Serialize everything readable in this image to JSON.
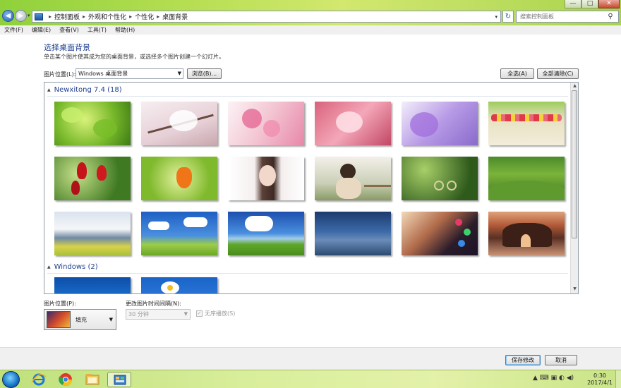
{
  "window": {
    "breadcrumbs": [
      "控制面板",
      "外观和个性化",
      "个性化",
      "桌面背景"
    ],
    "search_placeholder": "搜索控制面板",
    "controls": {
      "minimize": "—",
      "maximize": "□",
      "close": "✕"
    }
  },
  "menu": [
    "文件(F)",
    "编辑(E)",
    "查看(V)",
    "工具(T)",
    "帮助(H)"
  ],
  "main": {
    "title": "选择桌面背景",
    "description": "单击某个图片使其成为您的桌面背景，或选择多个图片创建一个幻灯片。",
    "location_label": "图片位置(L):",
    "location_value": "Windows 桌面背景",
    "browse_label": "浏览(B)...",
    "select_all_label": "全选(A)",
    "clear_all_label": "全部清除(C)"
  },
  "groups": [
    {
      "name": "Newxitong 7.4 (18)"
    },
    {
      "name": "Windows (2)"
    }
  ],
  "thumbnails": [
    {
      "name": "green-leaves"
    },
    {
      "name": "cherry-blossom-white"
    },
    {
      "name": "pink-blossom"
    },
    {
      "name": "peach-blossom"
    },
    {
      "name": "purple-flowers"
    },
    {
      "name": "tulip-field"
    },
    {
      "name": "red-tulips"
    },
    {
      "name": "lantern-flower"
    },
    {
      "name": "portrait-woman"
    },
    {
      "name": "girl-fence"
    },
    {
      "name": "bicycle-forest"
    },
    {
      "name": "green-hills"
    },
    {
      "name": "mountain-clouds"
    },
    {
      "name": "blue-sky-meadow"
    },
    {
      "name": "sky-field"
    },
    {
      "name": "evening-sky"
    },
    {
      "name": "cup-bokeh"
    },
    {
      "name": "sea-rock-arch"
    },
    {
      "name": "windows-blue"
    },
    {
      "name": "daisy-blue"
    }
  ],
  "bottom": {
    "position_label": "图片位置(P):",
    "position_value": "填充",
    "interval_label": "更改图片时间间隔(N):",
    "interval_value": "30 分钟",
    "shuffle_label": "无序播放(S)"
  },
  "footer": {
    "save_label": "保存修改",
    "cancel_label": "取消"
  },
  "taskbar": {
    "time": "0:30",
    "date": "2017/4/1"
  }
}
